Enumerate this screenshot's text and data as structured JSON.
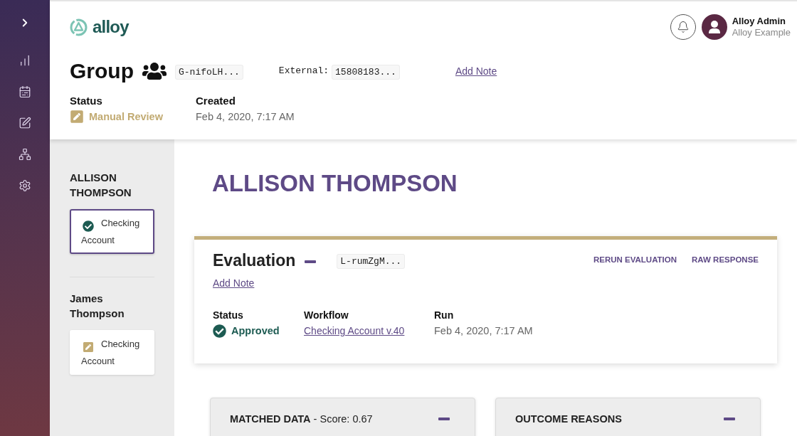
{
  "header": {
    "logo": "alloy",
    "user": {
      "name": "Alloy Admin",
      "organization": "Alloy Example"
    }
  },
  "group": {
    "title": "Group",
    "id": "G-nifoLH...",
    "external_label": "External:",
    "external_id": "15808183...",
    "add_note": "Add Note",
    "fields": [
      {
        "label": "Status",
        "kind": "review",
        "value": "Manual Review"
      },
      {
        "label": "Created",
        "kind": "text",
        "value": "Feb 4, 2020, 7:17 AM"
      }
    ]
  },
  "entities": [
    {
      "name": "ALLISON THOMPSON",
      "applications": [
        {
          "label": "Checking Account",
          "kind": "approved",
          "selected": true
        }
      ]
    },
    {
      "name": "James Thompson",
      "applications": [
        {
          "label": "Checking Account",
          "kind": "review",
          "selected": false
        }
      ]
    }
  ],
  "detail": {
    "title": "ALLISON THOMPSON",
    "evaluation": {
      "title": "Evaluation",
      "expanded": true,
      "id": "L-rumZgM...",
      "actions": [
        "RERUN EVALUATION",
        "RAW RESPONSE"
      ],
      "add_note": "Add Note",
      "fields": [
        {
          "label": "Status",
          "kind": "approved",
          "value": "Approved"
        },
        {
          "label": "Workflow",
          "kind": "link",
          "value": "Checking Account v.40"
        },
        {
          "label": "Run",
          "kind": "text",
          "value": "Feb 4, 2020, 7:17 AM"
        }
      ]
    },
    "panels": [
      {
        "title": "MATCHED DATA",
        "detail": "- Score: 0.67",
        "expanded": true
      },
      {
        "title": "OUTCOME REASONS",
        "expanded": true
      }
    ]
  }
}
